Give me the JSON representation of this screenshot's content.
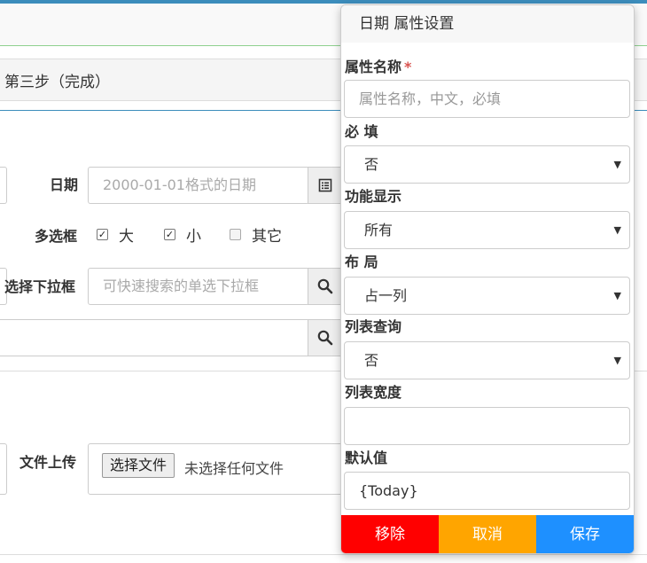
{
  "background": {
    "step_text": "第三步（完成）",
    "date_label": "日期",
    "date_placeholder": "2000-01-01格式的日期",
    "checkbox_label": "多选框",
    "checkbox_options": [
      {
        "label": "大",
        "checked": true
      },
      {
        "label": "小",
        "checked": true
      },
      {
        "label": "其它",
        "checked": false
      }
    ],
    "select_label": "选择下拉框",
    "select_placeholder": "可快速搜索的单选下拉框",
    "file_label": "文件上传",
    "file_button": "选择文件",
    "file_status": "未选择任何文件"
  },
  "panel": {
    "title": "日期 属性设置",
    "name_label": "属性名称",
    "name_required_mark": "*",
    "name_placeholder": "属性名称，中文，必填",
    "required_label": "必 填",
    "required_value": "否",
    "display_label": "功能显示",
    "display_value": "所有",
    "layout_label": "布 局",
    "layout_value": "占一列",
    "list_query_label": "列表查询",
    "list_query_value": "否",
    "list_width_label": "列表宽度",
    "list_width_value": "",
    "default_label": "默认值",
    "default_value": "{Today}",
    "buttons": {
      "remove": "移除",
      "cancel": "取消",
      "save": "保存"
    }
  },
  "colors": {
    "remove": "#ff0000",
    "cancel": "#ffa500",
    "save": "#1e90ff",
    "required": "#d9534f"
  }
}
